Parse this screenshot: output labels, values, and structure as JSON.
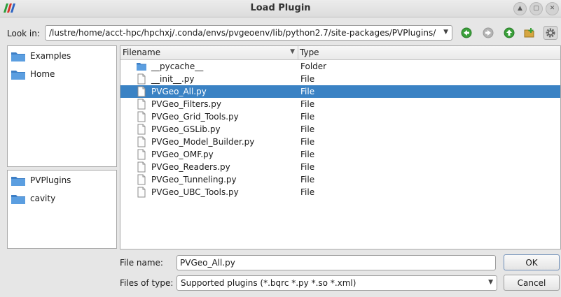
{
  "window": {
    "title": "Load Plugin",
    "buttons": [
      "▲",
      "▢",
      "✕"
    ]
  },
  "lookin": {
    "label": "Look in:",
    "path": "/lustre/home/acct-hpc/hpchxj/.conda/envs/pvgeoenv/lib/python2.7/site-packages/PVPlugins/"
  },
  "sidebar": {
    "top_items": [
      {
        "label": "Examples"
      },
      {
        "label": "Home"
      }
    ],
    "bottom_items": [
      {
        "label": "PVPlugins"
      },
      {
        "label": "cavity"
      }
    ]
  },
  "file_list": {
    "headers": {
      "filename": "Filename",
      "type": "Type"
    },
    "rows": [
      {
        "name": "__pycache__",
        "type": "Folder",
        "icon": "folder-icon",
        "selected": false
      },
      {
        "name": "__init__.py",
        "type": "File",
        "icon": "file-icon",
        "selected": false
      },
      {
        "name": "PVGeo_All.py",
        "type": "File",
        "icon": "file-icon",
        "selected": true
      },
      {
        "name": "PVGeo_Filters.py",
        "type": "File",
        "icon": "file-icon",
        "selected": false
      },
      {
        "name": "PVGeo_Grid_Tools.py",
        "type": "File",
        "icon": "file-icon",
        "selected": false
      },
      {
        "name": "PVGeo_GSLib.py",
        "type": "File",
        "icon": "file-icon",
        "selected": false
      },
      {
        "name": "PVGeo_Model_Builder.py",
        "type": "File",
        "icon": "file-icon",
        "selected": false
      },
      {
        "name": "PVGeo_OMF.py",
        "type": "File",
        "icon": "file-icon",
        "selected": false
      },
      {
        "name": "PVGeo_Readers.py",
        "type": "File",
        "icon": "file-icon",
        "selected": false
      },
      {
        "name": "PVGeo_Tunneling.py",
        "type": "File",
        "icon": "file-icon",
        "selected": false
      },
      {
        "name": "PVGeo_UBC_Tools.py",
        "type": "File",
        "icon": "file-icon",
        "selected": false
      }
    ]
  },
  "filename": {
    "label": "File name:",
    "value": "PVGeo_All.py"
  },
  "filetype": {
    "label": "Files of type:",
    "value": "Supported plugins (*.bqrc *.py *.so *.xml)"
  },
  "actions": {
    "ok": "OK",
    "cancel": "Cancel"
  },
  "colors": {
    "selection": "#3a82c4",
    "folder": "#3d7fc6"
  }
}
